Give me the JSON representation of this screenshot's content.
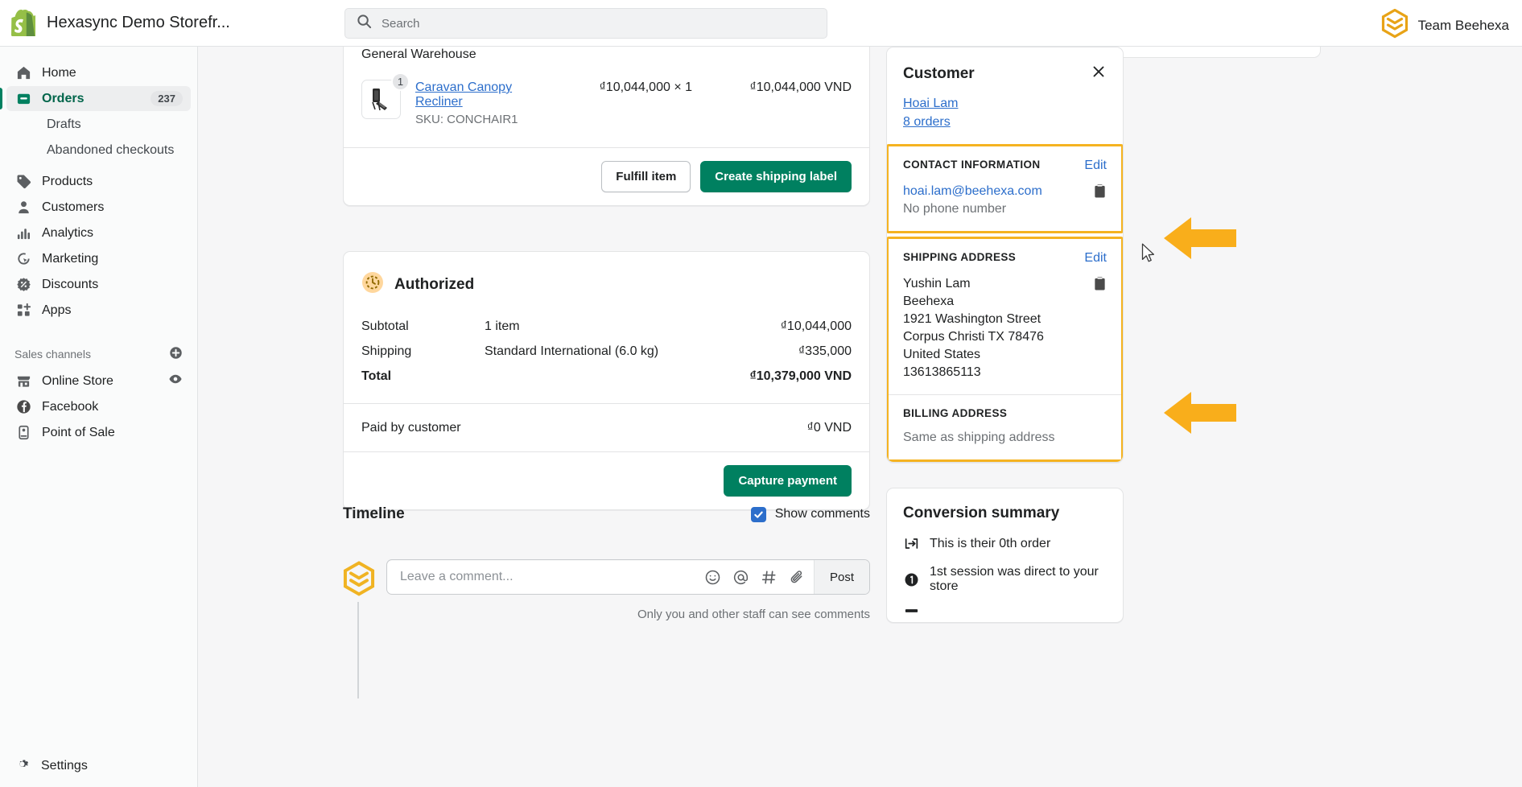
{
  "topbar": {
    "store_name": "Hexasync Demo Storefr...",
    "search_placeholder": "Search",
    "team_label": "Team Beehexa",
    "logo_icon": "shopify-bag-icon",
    "search_icon": "search-icon",
    "team_icon": "beehexa-hexagon-icon"
  },
  "sidebar": {
    "items": [
      {
        "label": "Home",
        "icon": "home-icon"
      },
      {
        "label": "Orders",
        "icon": "orders-inbox-icon",
        "badge": "237",
        "active": true
      },
      {
        "label": "Drafts",
        "sub": true
      },
      {
        "label": "Abandoned checkouts",
        "sub": true
      },
      {
        "label": "Products",
        "icon": "tag-icon"
      },
      {
        "label": "Customers",
        "icon": "person-icon"
      },
      {
        "label": "Analytics",
        "icon": "bar-chart-icon"
      },
      {
        "label": "Marketing",
        "icon": "marketing-target-icon"
      },
      {
        "label": "Discounts",
        "icon": "discount-percent-icon"
      },
      {
        "label": "Apps",
        "icon": "apps-grid-icon"
      }
    ],
    "sales_channels": {
      "label": "Sales channels",
      "add_icon": "plus-circle-icon",
      "items": [
        {
          "label": "Online Store",
          "icon": "storefront-icon",
          "trailing_icon": "eye-icon"
        },
        {
          "label": "Facebook",
          "icon": "facebook-icon"
        },
        {
          "label": "Point of Sale",
          "icon": "pos-device-icon"
        }
      ]
    },
    "settings": {
      "label": "Settings",
      "icon": "gear-icon"
    }
  },
  "fulfillment": {
    "warehouse": "General Warehouse",
    "item": {
      "quantity": "1",
      "title": "Caravan Canopy Recliner",
      "sku": "SKU: CONCHAIR1",
      "unit_price": "₫10,044,000 × 1",
      "line_total": "₫10,044,000 VND",
      "thumb_icon": "recliner-chair-photo"
    },
    "fulfill_button": "Fulfill item",
    "shipping_label_button": "Create shipping label"
  },
  "payment": {
    "status": "Authorized",
    "status_icon": "clock-pending-icon",
    "rows": [
      {
        "label": "Subtotal",
        "detail": "1 item",
        "amount": "₫10,044,000"
      },
      {
        "label": "Shipping",
        "detail": "Standard International (6.0 kg)",
        "amount": "₫335,000"
      },
      {
        "label": "Total",
        "detail": "",
        "amount": "₫10,379,000 VND",
        "bold": true
      }
    ],
    "paid_label": "Paid by customer",
    "paid_amount": "₫0 VND",
    "capture_button": "Capture payment"
  },
  "timeline": {
    "title": "Timeline",
    "show_comments_label": "Show comments",
    "comment_placeholder": "Leave a comment...",
    "post_button": "Post",
    "note": "Only you and other staff can see comments",
    "icons": [
      "emoji-smiley-icon",
      "mention-at-icon",
      "hashtag-icon",
      "paperclip-icon"
    ],
    "avatar_icon": "beehexa-hexagon-icon"
  },
  "customer": {
    "title": "Customer",
    "close_icon": "close-icon",
    "name": "Hoai Lam",
    "orders_link": "8 orders",
    "contact": {
      "title": "CONTACT INFORMATION",
      "edit": "Edit",
      "email": "hoai.lam@beehexa.com",
      "phone": "No phone number",
      "copy_icon": "clipboard-copy-icon",
      "highlighted": true
    },
    "shipping": {
      "title": "SHIPPING ADDRESS",
      "edit": "Edit",
      "lines": [
        "Yushin Lam",
        "Beehexa",
        "1921 Washington Street",
        "Corpus Christi TX 78476",
        "United States",
        "13613865113"
      ],
      "copy_icon": "clipboard-copy-icon",
      "highlighted": true
    },
    "billing": {
      "title": "BILLING ADDRESS",
      "value": "Same as shipping address"
    }
  },
  "conversion": {
    "title": "Conversion summary",
    "rows": [
      {
        "text": "This is their 0th order",
        "icon": "return-order-icon"
      },
      {
        "text": "1st session was direct to your store",
        "icon": "number-one-circle-icon"
      }
    ]
  },
  "annotations": {
    "arrow_color": "#f9ae1b",
    "arrows": [
      {
        "name": "arrow-contact-information"
      },
      {
        "name": "arrow-shipping-address"
      }
    ],
    "cursor": "mouse-pointer"
  },
  "colors": {
    "accent_green": "#008060",
    "link_blue": "#2c6ecb",
    "highlight_amber": "#f5b321",
    "checkbox_blue": "#2c6ecb"
  }
}
